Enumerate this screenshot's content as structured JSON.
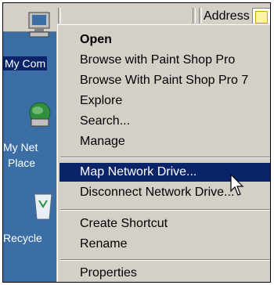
{
  "toolbar": {
    "address_label": "Address",
    "address_icon": "folder-icon"
  },
  "desktop": {
    "icons": [
      {
        "label": "My Com",
        "icon": "my-computer-icon",
        "selected": true
      },
      {
        "label": "My Net",
        "label2": "Place",
        "icon": "network-places-icon"
      },
      {
        "label": "Recycle",
        "icon": "recycle-bin-icon"
      }
    ]
  },
  "context_menu": {
    "groups": [
      [
        {
          "label": "Open",
          "bold": true
        },
        {
          "label": "Browse with Paint Shop Pro"
        },
        {
          "label": "Browse With Paint Shop Pro 7"
        },
        {
          "label": "Explore"
        },
        {
          "label": "Search..."
        },
        {
          "label": "Manage"
        }
      ],
      [
        {
          "label": "Map Network Drive...",
          "highlighted": true
        },
        {
          "label": "Disconnect Network Drive..."
        }
      ],
      [
        {
          "label": "Create Shortcut"
        },
        {
          "label": "Rename"
        }
      ],
      [
        {
          "label": "Properties"
        }
      ]
    ]
  },
  "colors": {
    "desktop": "#3a6ea5",
    "menu_bg": "#d4d0c8",
    "highlight": "#0a246a"
  }
}
